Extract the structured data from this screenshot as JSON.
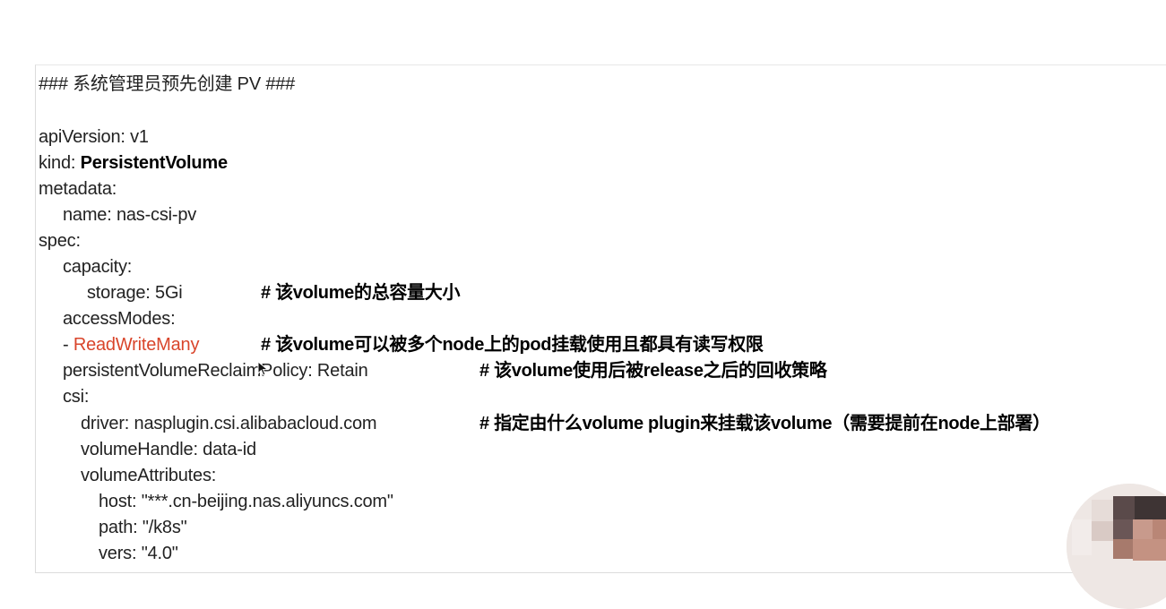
{
  "doc": {
    "header": "### 系统管理员预先创建 PV ###",
    "lines": {
      "apiVersion": "apiVersion: v1",
      "kind_key": "kind: ",
      "kind_val": "PersistentVolume",
      "metadata": "metadata:",
      "name": "name: nas-csi-pv",
      "spec": "spec:",
      "capacity": "capacity:",
      "storage": "storage: 5Gi",
      "accessModes": "accessModes:",
      "mode_dash": "- ",
      "mode_val": "ReadWriteMany",
      "reclaim": "persistentVolumeReclaimPolicy: Retain",
      "csi": "csi:",
      "driver": "driver: nasplugin.csi.alibabacloud.com",
      "volumeHandle": "volumeHandle: data-id",
      "volumeAttributes": "volumeAttributes:",
      "host": "host: \"***.cn-beijing.nas.aliyuncs.com\"",
      "path": "path: \"/k8s\"",
      "vers": "vers: \"4.0\""
    },
    "comments": {
      "storage": "# 该volume的总容量大小",
      "mode": "# 该volume可以被多个node上的pod挂载使用且都具有读写权限",
      "reclaim": "# 该volume使用后被release之后的回收策略",
      "driver": "# 指定由什么volume plugin来挂载该volume（需要提前在node上部署）"
    }
  },
  "colors": {
    "text": "#222222",
    "highlight": "#d9452b",
    "comment": "#000000"
  },
  "icons": {
    "cursor": "mouse-pointer-icon",
    "avatar": "presenter-avatar"
  }
}
